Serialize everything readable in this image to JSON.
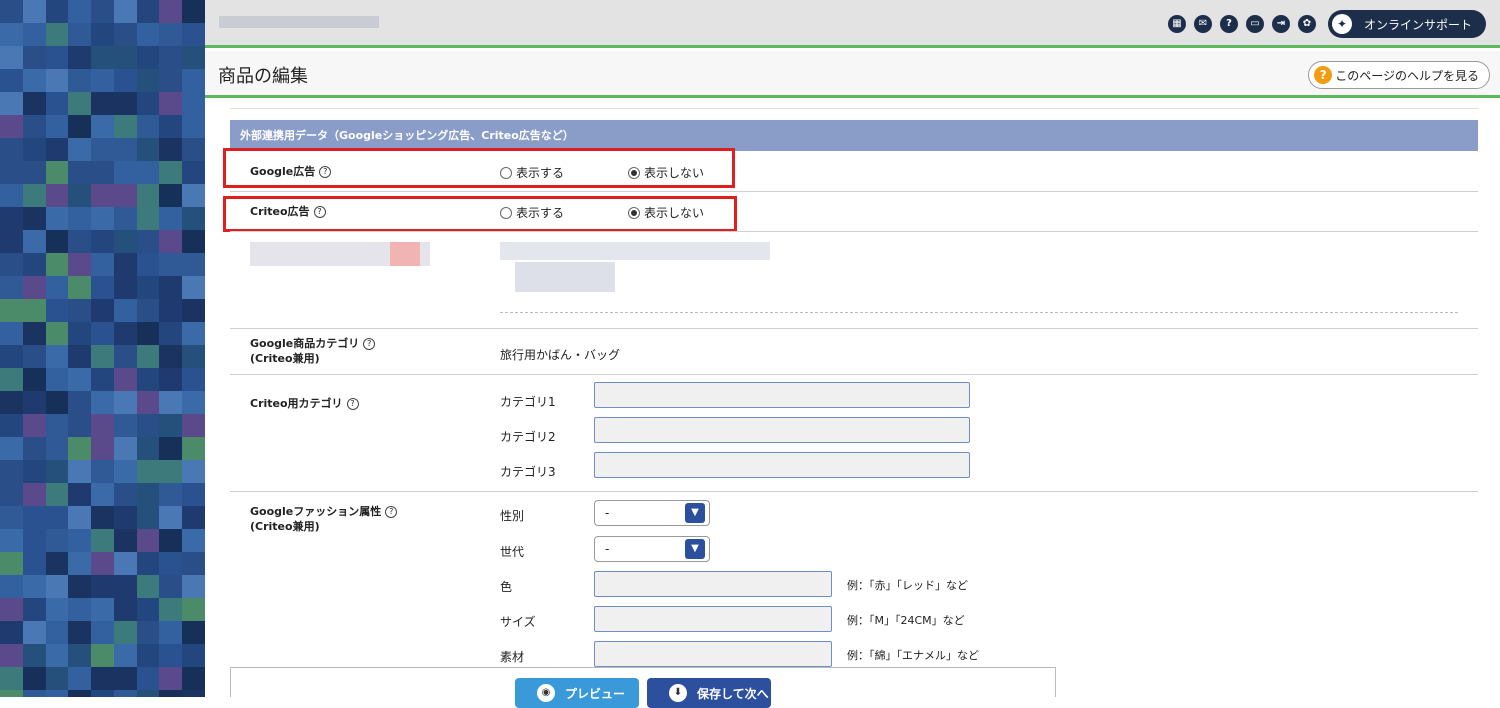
{
  "header": {
    "icons": [
      "calculator-icon",
      "mail-icon",
      "help-icon",
      "chat-icon",
      "logout-icon",
      "settings-icon"
    ],
    "icon_glyphs": [
      "▦",
      "✉",
      "?",
      "▭",
      "⇥",
      "✿"
    ],
    "support_label": "オンラインサポート"
  },
  "page": {
    "title": "商品の編集",
    "help_label": "このページのヘルプを見る"
  },
  "section": {
    "title": "外部連携用データ（Googleショッピング広告、Criteo広告など）"
  },
  "google_ads": {
    "label": "Google広告",
    "option_show": "表示する",
    "option_hide": "表示しない",
    "selected": "表示しない"
  },
  "criteo_ads": {
    "label": "Criteo広告",
    "option_show": "表示する",
    "option_hide": "表示しない",
    "selected": "表示しない"
  },
  "google_category": {
    "label": "Google商品カテゴリ",
    "sublabel": "(Criteo兼用)",
    "value": "旅行用かばん・バッグ"
  },
  "criteo_category": {
    "label": "Criteo用カテゴリ",
    "fields": [
      {
        "label": "カテゴリ1",
        "value": ""
      },
      {
        "label": "カテゴリ2",
        "value": ""
      },
      {
        "label": "カテゴリ3",
        "value": ""
      }
    ]
  },
  "fashion": {
    "label": "Googleファッション属性",
    "sublabel": "(Criteo兼用)",
    "gender_label": "性別",
    "gender_value": "-",
    "age_label": "世代",
    "age_value": "-",
    "color_label": "色",
    "color_hint": "例：「赤」「レッド」など",
    "size_label": "サイズ",
    "size_hint": "例：「M」「24CM」など",
    "material_label": "素材",
    "material_hint": "例：「綿」「エナメル」など"
  },
  "footer": {
    "preview_label": "プレビュー",
    "save_next_label": "保存して次へ"
  },
  "colors": {
    "accent_green": "#5cb85c",
    "section_header": "#8a9cc8",
    "highlight_red": "#e02020",
    "preview_button": "#3a9ad9",
    "save_button": "#2c4f9e"
  }
}
